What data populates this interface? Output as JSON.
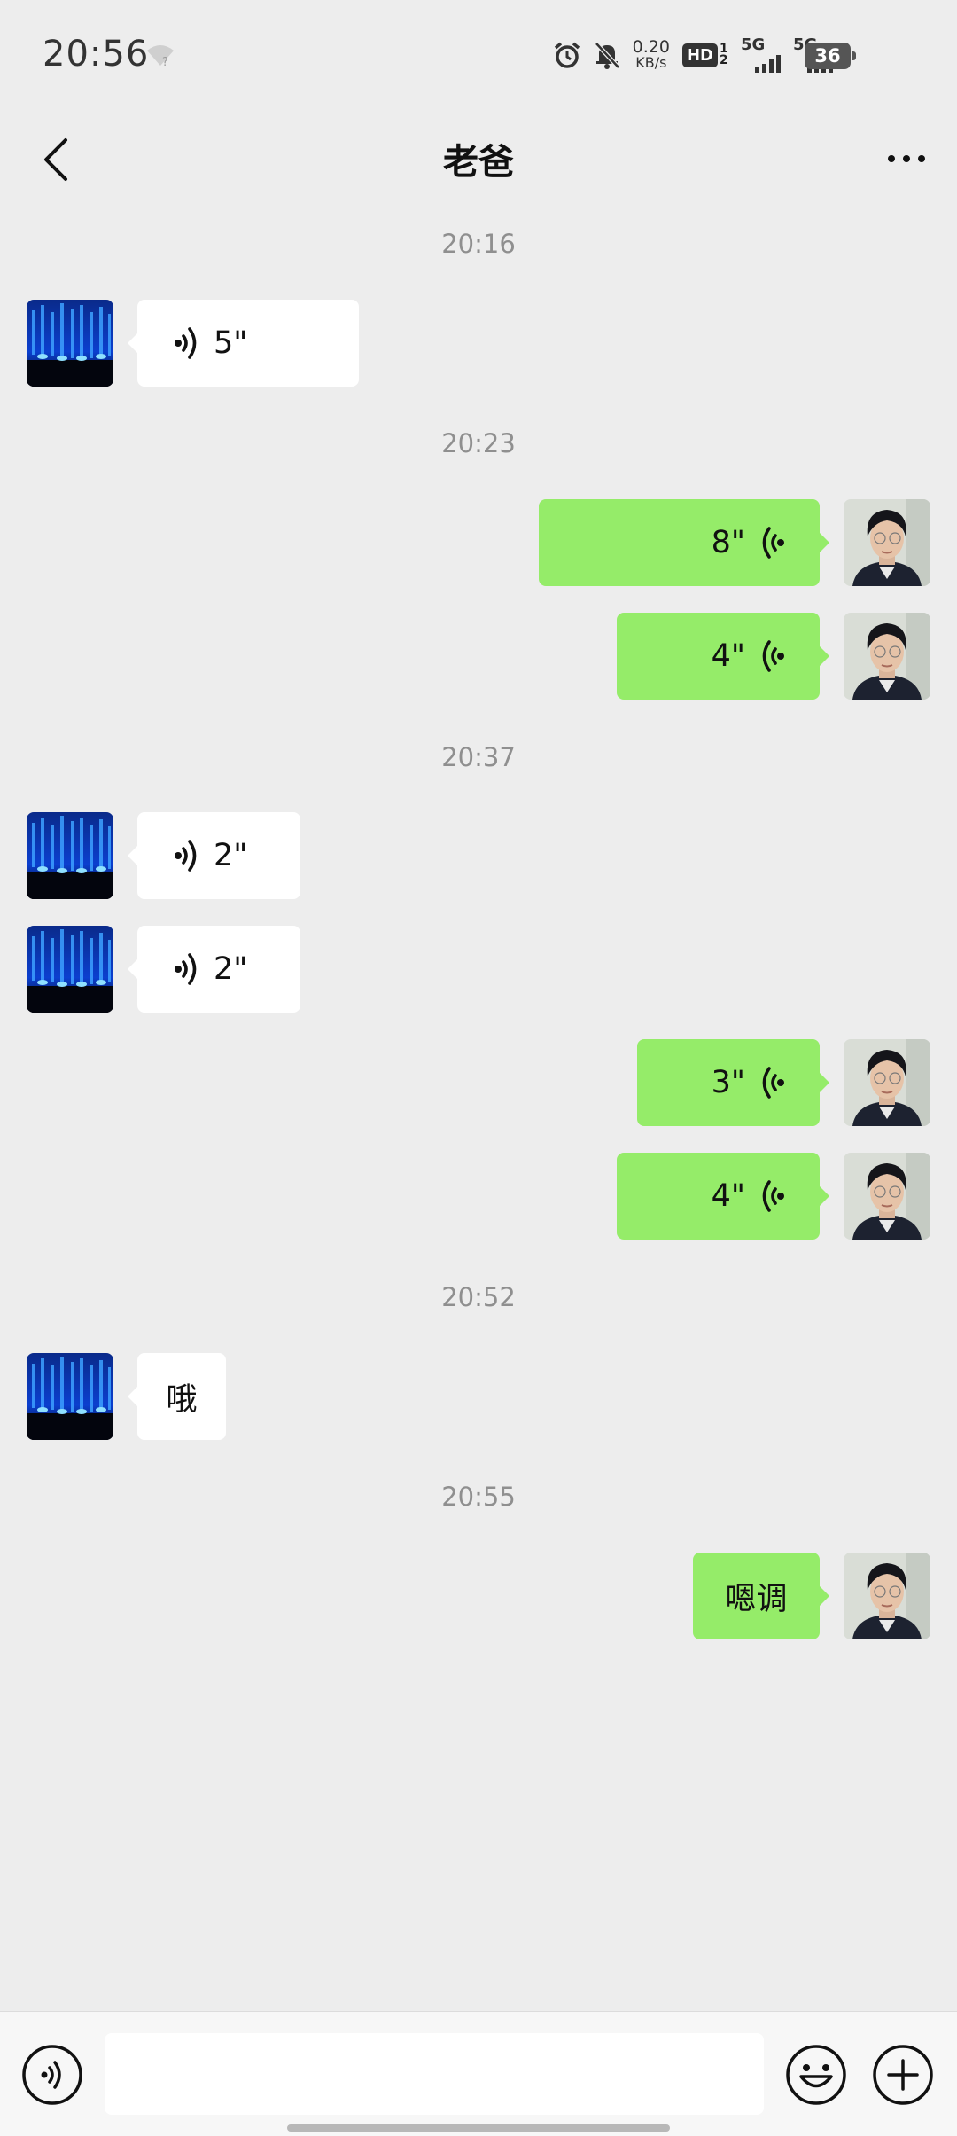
{
  "status_bar": {
    "time": "20:56",
    "net_speed_value": "0.20",
    "net_speed_unit": "KB/s",
    "hd_label": "HD",
    "hd_sub": "1 2",
    "signal_1_label": "5G",
    "signal_2_label": "5G",
    "battery": "36"
  },
  "header": {
    "title": "老爸"
  },
  "messages": [
    {
      "type": "timestamp",
      "text": "20:16"
    },
    {
      "type": "voice",
      "side": "in",
      "duration": "5\""
    },
    {
      "type": "timestamp",
      "text": "20:23"
    },
    {
      "type": "voice",
      "side": "out",
      "duration": "8\""
    },
    {
      "type": "voice",
      "side": "out",
      "duration": "4\""
    },
    {
      "type": "timestamp",
      "text": "20:37"
    },
    {
      "type": "voice",
      "side": "in",
      "duration": "2\""
    },
    {
      "type": "voice",
      "side": "in",
      "duration": "2\""
    },
    {
      "type": "voice",
      "side": "out",
      "duration": "3\""
    },
    {
      "type": "voice",
      "side": "out",
      "duration": "4\""
    },
    {
      "type": "timestamp",
      "text": "20:52"
    },
    {
      "type": "text",
      "side": "in",
      "text": "哦"
    },
    {
      "type": "timestamp",
      "text": "20:55"
    },
    {
      "type": "text",
      "side": "out",
      "text": "嗯调"
    }
  ],
  "input_bar": {
    "placeholder": "",
    "value": ""
  },
  "icons": {
    "back": "chevron-left-icon",
    "more": "more-dots-icon",
    "voice": "voice-icon",
    "emoji": "emoji-icon",
    "add": "plus-icon"
  },
  "colors": {
    "background": "#ededed",
    "outgoing_bubble": "#95ec69",
    "incoming_bubble": "#ffffff",
    "timestamp": "#8f8f8f"
  }
}
